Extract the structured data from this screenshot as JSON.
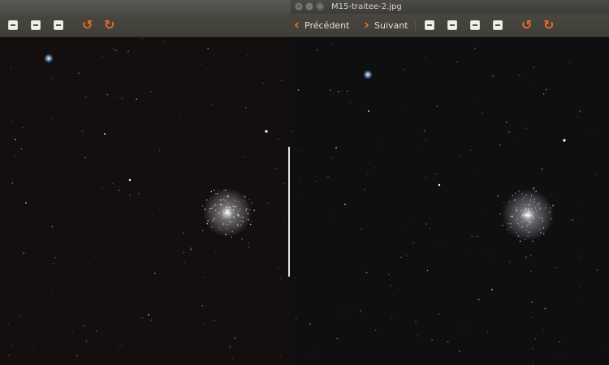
{
  "right_window": {
    "title": "M15-traitee-2.jpg",
    "previous_label": "Précédent",
    "next_label": "Suivant"
  },
  "icons": {
    "window_close": "close-icon",
    "window_minimize": "minimize-icon",
    "window_maximize": "maximize-icon",
    "toolbar": [
      "save-icon",
      "fit-window-icon",
      "zoom-original-icon",
      "fullscreen-icon",
      "rotate-left-icon",
      "rotate-right-icon",
      "previous-arrow-icon",
      "next-arrow-icon"
    ]
  },
  "colors": {
    "accent_orange": "#e8732c",
    "toolbar_bg": "#45443e",
    "image_bg_left": "#140f0e",
    "image_bg_right": "#0f0e10"
  }
}
